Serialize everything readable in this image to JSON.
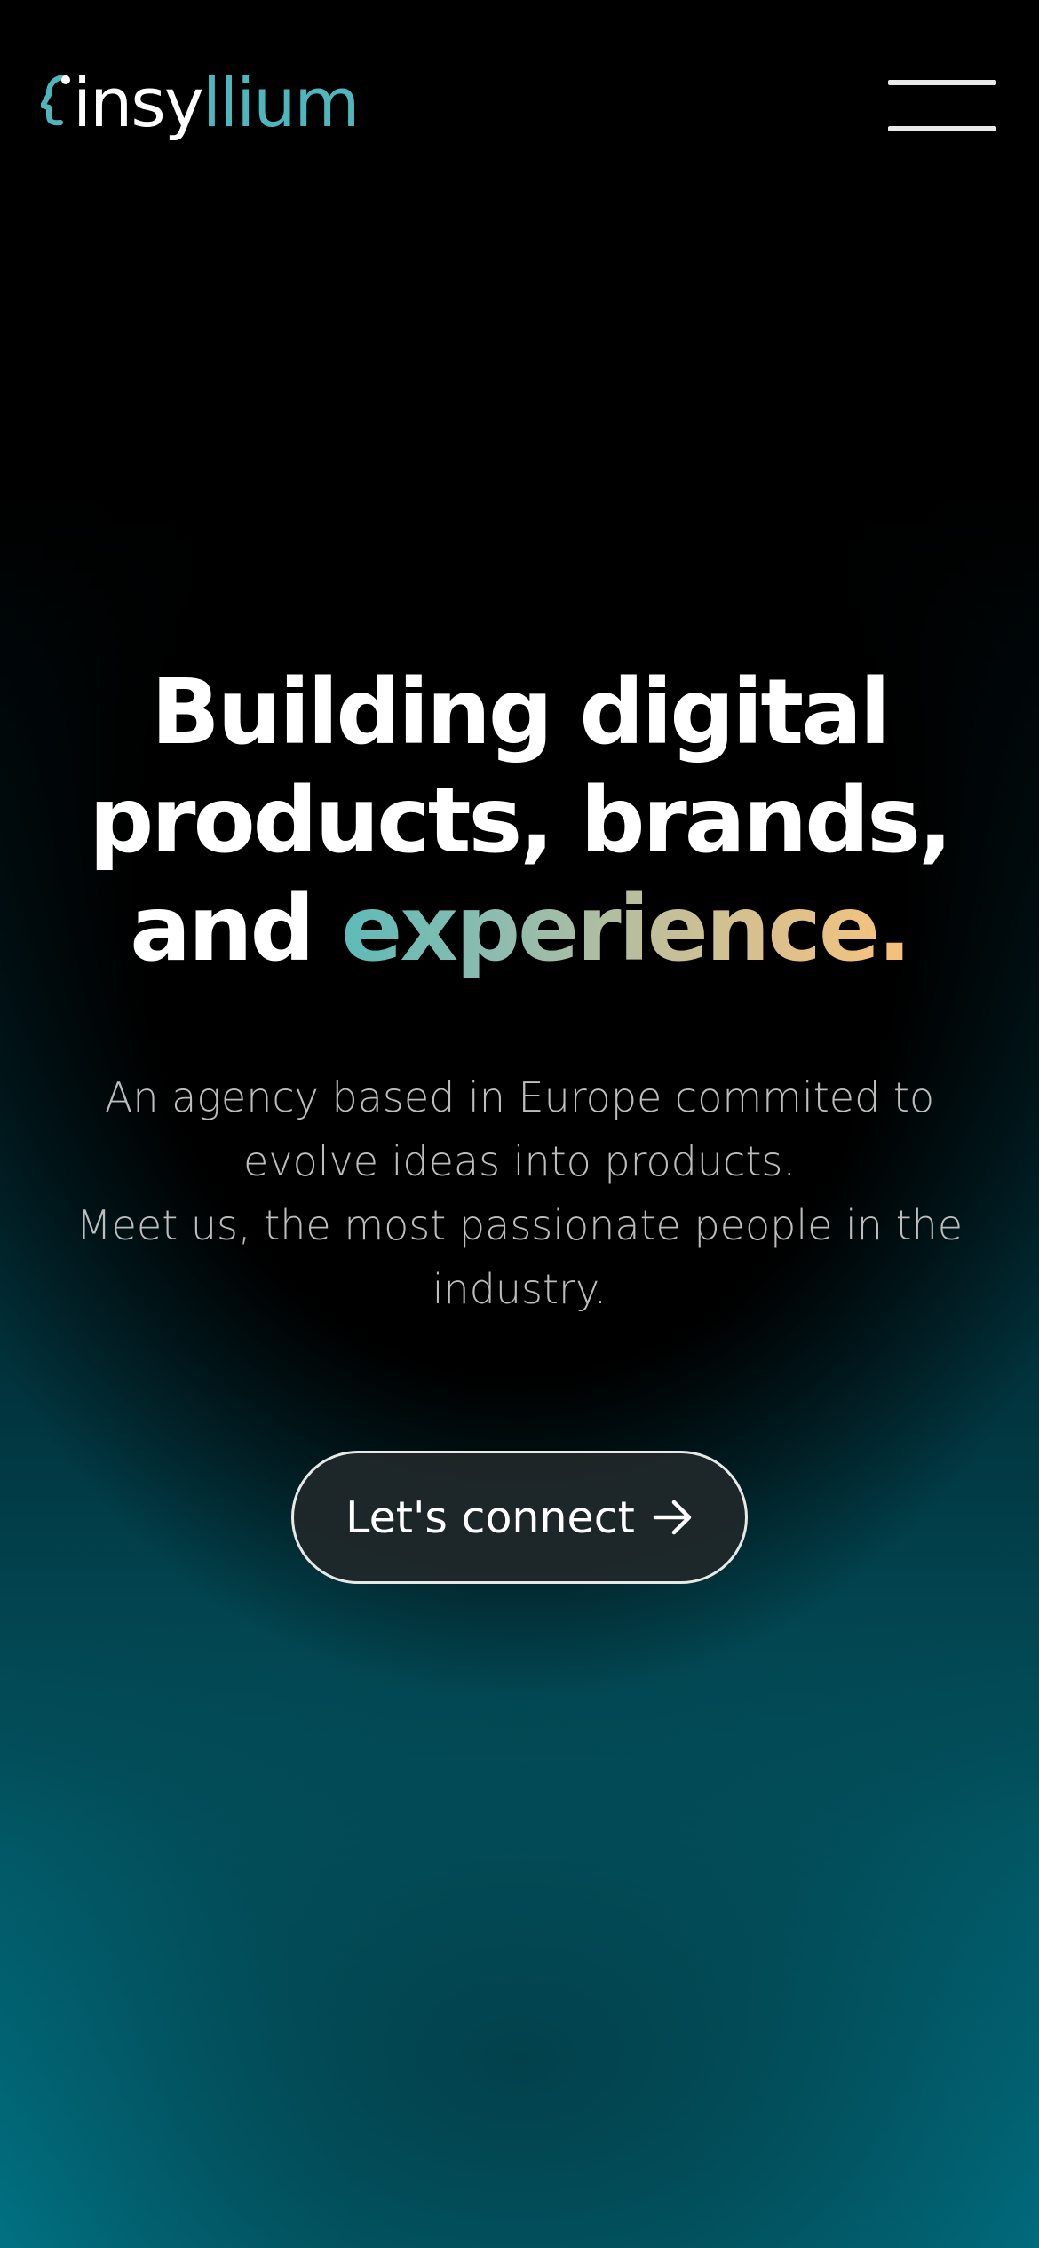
{
  "header": {
    "logo_part1": "insy",
    "logo_part2": "llium",
    "logo_icon": "head-profile-icon",
    "menu_icon": "hamburger-menu-icon"
  },
  "hero": {
    "title_line1": "Building digital",
    "title_line2": "products, brands,",
    "title_line3_start": "and ",
    "title_accent": "experience",
    "title_dot": ".",
    "subtitle_line1": "An agency based in Europe commited to",
    "subtitle_line2": "evolve ideas into products.",
    "subtitle_line3": "Meet us, the most passionate people in the",
    "subtitle_line4": "industry.",
    "cta_label": "Let's connect",
    "cta_icon": "arrow-right-icon"
  },
  "colors": {
    "background_top": "#000000",
    "background_bottom": "#026a79",
    "brand_teal": "#4fb6be",
    "accent_gradient_start": "#5dbbb8",
    "accent_gradient_end": "#f2c27f"
  }
}
